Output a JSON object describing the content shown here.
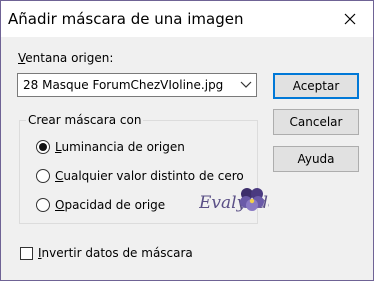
{
  "dialog": {
    "title": "Añadir máscara de una imagen",
    "close_symbol": "✕"
  },
  "source": {
    "label_mnemonic": "V",
    "label_rest": "entana origen:",
    "selected_value": "28 Masque ForumChezVIoline.jpg"
  },
  "buttons": {
    "accept": "Aceptar",
    "cancel": "Cancelar",
    "help": "Ayuda"
  },
  "mask_group": {
    "legend": "Crear máscara con",
    "options": [
      {
        "mnemonic": "L",
        "rest": "uminancia de origen",
        "selected": true
      },
      {
        "mnemonic": "C",
        "rest": "ualquier valor distinto de cero",
        "selected": false
      },
      {
        "mnemonic": "O",
        "rest": "pacidad de orige",
        "selected": false
      }
    ]
  },
  "invert": {
    "mnemonic": "I",
    "rest": "nvertir datos de máscara",
    "checked": false
  },
  "watermark": {
    "text": "Evalynda",
    "icon": "pansy-flower-icon"
  },
  "colors": {
    "background": "#5a4f86",
    "accent": "#0078d7"
  }
}
